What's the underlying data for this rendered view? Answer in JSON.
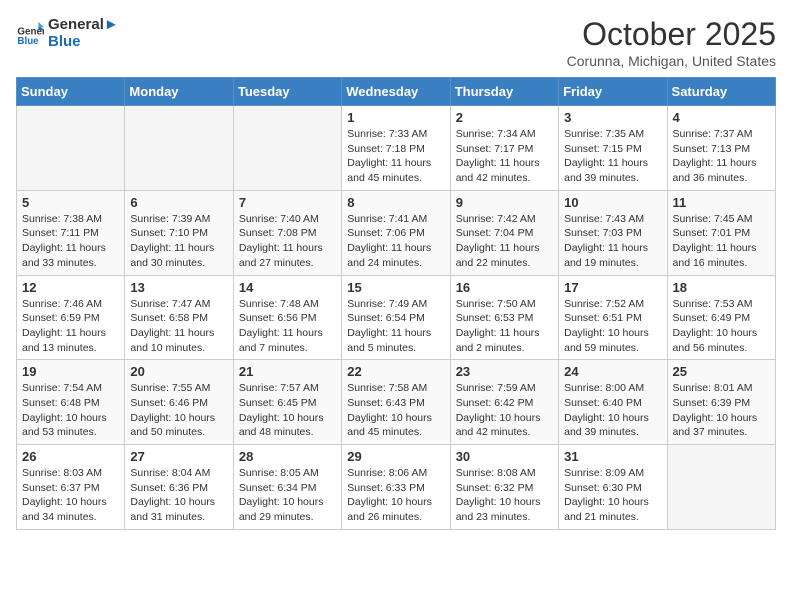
{
  "header": {
    "logo_line1": "General",
    "logo_line2": "Blue",
    "month": "October 2025",
    "location": "Corunna, Michigan, United States"
  },
  "weekdays": [
    "Sunday",
    "Monday",
    "Tuesday",
    "Wednesday",
    "Thursday",
    "Friday",
    "Saturday"
  ],
  "weeks": [
    [
      {
        "day": "",
        "info": ""
      },
      {
        "day": "",
        "info": ""
      },
      {
        "day": "",
        "info": ""
      },
      {
        "day": "1",
        "info": "Sunrise: 7:33 AM\nSunset: 7:18 PM\nDaylight: 11 hours and 45 minutes."
      },
      {
        "day": "2",
        "info": "Sunrise: 7:34 AM\nSunset: 7:17 PM\nDaylight: 11 hours and 42 minutes."
      },
      {
        "day": "3",
        "info": "Sunrise: 7:35 AM\nSunset: 7:15 PM\nDaylight: 11 hours and 39 minutes."
      },
      {
        "day": "4",
        "info": "Sunrise: 7:37 AM\nSunset: 7:13 PM\nDaylight: 11 hours and 36 minutes."
      }
    ],
    [
      {
        "day": "5",
        "info": "Sunrise: 7:38 AM\nSunset: 7:11 PM\nDaylight: 11 hours and 33 minutes."
      },
      {
        "day": "6",
        "info": "Sunrise: 7:39 AM\nSunset: 7:10 PM\nDaylight: 11 hours and 30 minutes."
      },
      {
        "day": "7",
        "info": "Sunrise: 7:40 AM\nSunset: 7:08 PM\nDaylight: 11 hours and 27 minutes."
      },
      {
        "day": "8",
        "info": "Sunrise: 7:41 AM\nSunset: 7:06 PM\nDaylight: 11 hours and 24 minutes."
      },
      {
        "day": "9",
        "info": "Sunrise: 7:42 AM\nSunset: 7:04 PM\nDaylight: 11 hours and 22 minutes."
      },
      {
        "day": "10",
        "info": "Sunrise: 7:43 AM\nSunset: 7:03 PM\nDaylight: 11 hours and 19 minutes."
      },
      {
        "day": "11",
        "info": "Sunrise: 7:45 AM\nSunset: 7:01 PM\nDaylight: 11 hours and 16 minutes."
      }
    ],
    [
      {
        "day": "12",
        "info": "Sunrise: 7:46 AM\nSunset: 6:59 PM\nDaylight: 11 hours and 13 minutes."
      },
      {
        "day": "13",
        "info": "Sunrise: 7:47 AM\nSunset: 6:58 PM\nDaylight: 11 hours and 10 minutes."
      },
      {
        "day": "14",
        "info": "Sunrise: 7:48 AM\nSunset: 6:56 PM\nDaylight: 11 hours and 7 minutes."
      },
      {
        "day": "15",
        "info": "Sunrise: 7:49 AM\nSunset: 6:54 PM\nDaylight: 11 hours and 5 minutes."
      },
      {
        "day": "16",
        "info": "Sunrise: 7:50 AM\nSunset: 6:53 PM\nDaylight: 11 hours and 2 minutes."
      },
      {
        "day": "17",
        "info": "Sunrise: 7:52 AM\nSunset: 6:51 PM\nDaylight: 10 hours and 59 minutes."
      },
      {
        "day": "18",
        "info": "Sunrise: 7:53 AM\nSunset: 6:49 PM\nDaylight: 10 hours and 56 minutes."
      }
    ],
    [
      {
        "day": "19",
        "info": "Sunrise: 7:54 AM\nSunset: 6:48 PM\nDaylight: 10 hours and 53 minutes."
      },
      {
        "day": "20",
        "info": "Sunrise: 7:55 AM\nSunset: 6:46 PM\nDaylight: 10 hours and 50 minutes."
      },
      {
        "day": "21",
        "info": "Sunrise: 7:57 AM\nSunset: 6:45 PM\nDaylight: 10 hours and 48 minutes."
      },
      {
        "day": "22",
        "info": "Sunrise: 7:58 AM\nSunset: 6:43 PM\nDaylight: 10 hours and 45 minutes."
      },
      {
        "day": "23",
        "info": "Sunrise: 7:59 AM\nSunset: 6:42 PM\nDaylight: 10 hours and 42 minutes."
      },
      {
        "day": "24",
        "info": "Sunrise: 8:00 AM\nSunset: 6:40 PM\nDaylight: 10 hours and 39 minutes."
      },
      {
        "day": "25",
        "info": "Sunrise: 8:01 AM\nSunset: 6:39 PM\nDaylight: 10 hours and 37 minutes."
      }
    ],
    [
      {
        "day": "26",
        "info": "Sunrise: 8:03 AM\nSunset: 6:37 PM\nDaylight: 10 hours and 34 minutes."
      },
      {
        "day": "27",
        "info": "Sunrise: 8:04 AM\nSunset: 6:36 PM\nDaylight: 10 hours and 31 minutes."
      },
      {
        "day": "28",
        "info": "Sunrise: 8:05 AM\nSunset: 6:34 PM\nDaylight: 10 hours and 29 minutes."
      },
      {
        "day": "29",
        "info": "Sunrise: 8:06 AM\nSunset: 6:33 PM\nDaylight: 10 hours and 26 minutes."
      },
      {
        "day": "30",
        "info": "Sunrise: 8:08 AM\nSunset: 6:32 PM\nDaylight: 10 hours and 23 minutes."
      },
      {
        "day": "31",
        "info": "Sunrise: 8:09 AM\nSunset: 6:30 PM\nDaylight: 10 hours and 21 minutes."
      },
      {
        "day": "",
        "info": ""
      }
    ]
  ]
}
